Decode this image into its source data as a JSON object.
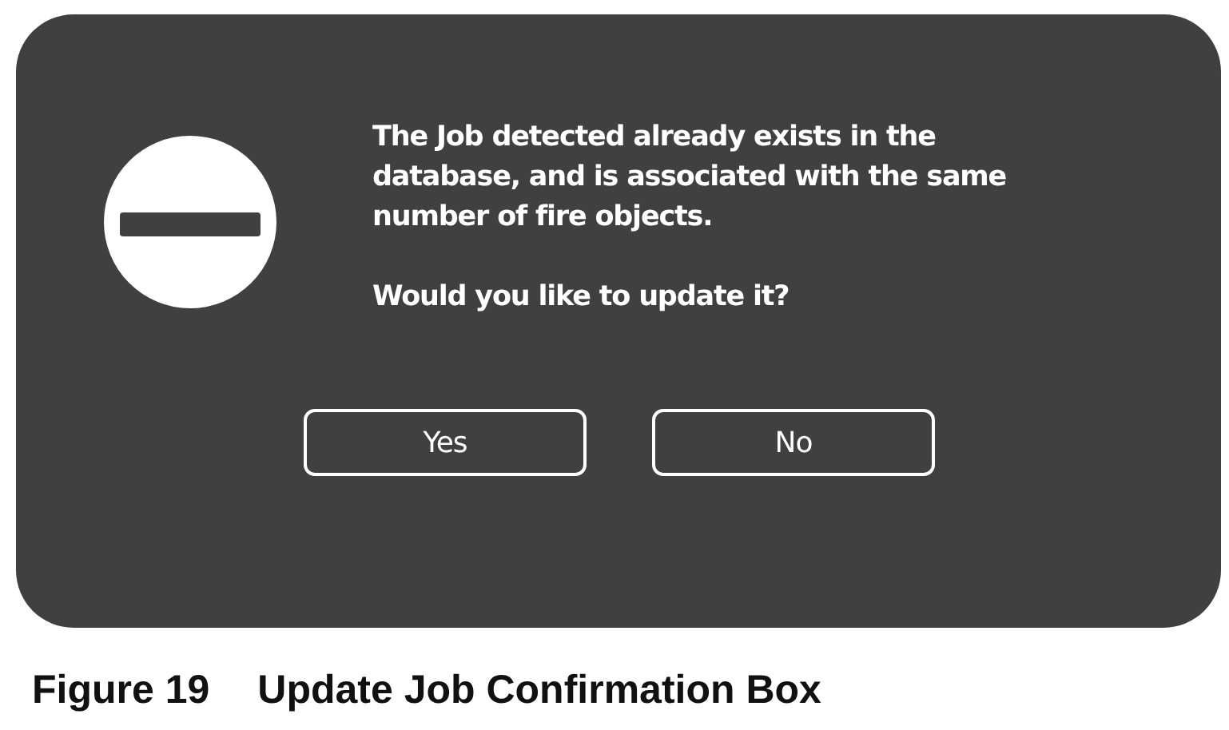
{
  "dialog": {
    "message": "The Job detected already exists in the database, and is associated with the same number of fire objects.",
    "question": "Would you like to update it?",
    "buttons": [
      {
        "label": "Yes"
      },
      {
        "label": "No"
      }
    ]
  },
  "caption": {
    "number": "Figure 19",
    "title": "Update Job Confirmation Box"
  }
}
